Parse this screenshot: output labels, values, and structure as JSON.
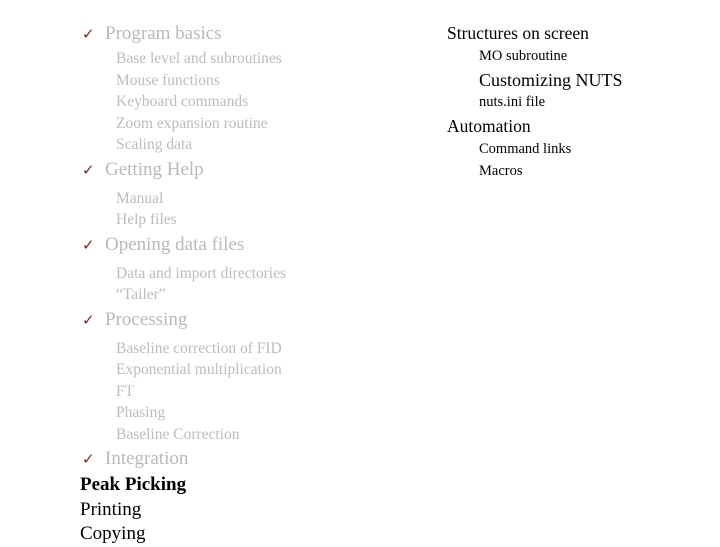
{
  "slide": {
    "background_color": "#ffffff",
    "bullet_glyph": "✓",
    "bullet_color": "#8c1d1d",
    "muted_text_color": "#b9b9b9",
    "text_color": "#000000"
  },
  "left_column": {
    "groups": [
      {
        "heading": "Program basics",
        "items": [
          "Base level and subroutines",
          "Mouse functions",
          "Keyboard commands",
          "Zoom expansion routine",
          "Scaling data"
        ]
      },
      {
        "heading": "Getting Help",
        "items": [
          "Manual",
          "Help files"
        ]
      },
      {
        "heading": "Opening data files",
        "items": [
          "Data and import directories",
          "“Tailer”"
        ]
      },
      {
        "heading": "Processing",
        "items": [
          "Baseline correction of FID",
          "Exponential multiplication",
          "FT",
          "Phasing",
          "Baseline Correction"
        ]
      },
      {
        "heading": "Integration",
        "items": []
      }
    ],
    "plain_items": [
      {
        "label": "Peak Picking",
        "bold": true
      },
      {
        "label": "Printing",
        "bold": false
      },
      {
        "label": "Copying",
        "bold": false
      }
    ]
  },
  "right_column": {
    "groups": [
      {
        "heading": "Structures on screen",
        "items": [
          {
            "label": "MO subroutine",
            "emphasis": false
          },
          {
            "label": "Customizing NUTS",
            "emphasis": true
          },
          {
            "label": "nuts.ini file",
            "emphasis": false
          }
        ]
      },
      {
        "heading": "Automation",
        "items": [
          {
            "label": "Command links",
            "emphasis": false
          },
          {
            "label": "Macros",
            "emphasis": false
          }
        ]
      }
    ]
  }
}
